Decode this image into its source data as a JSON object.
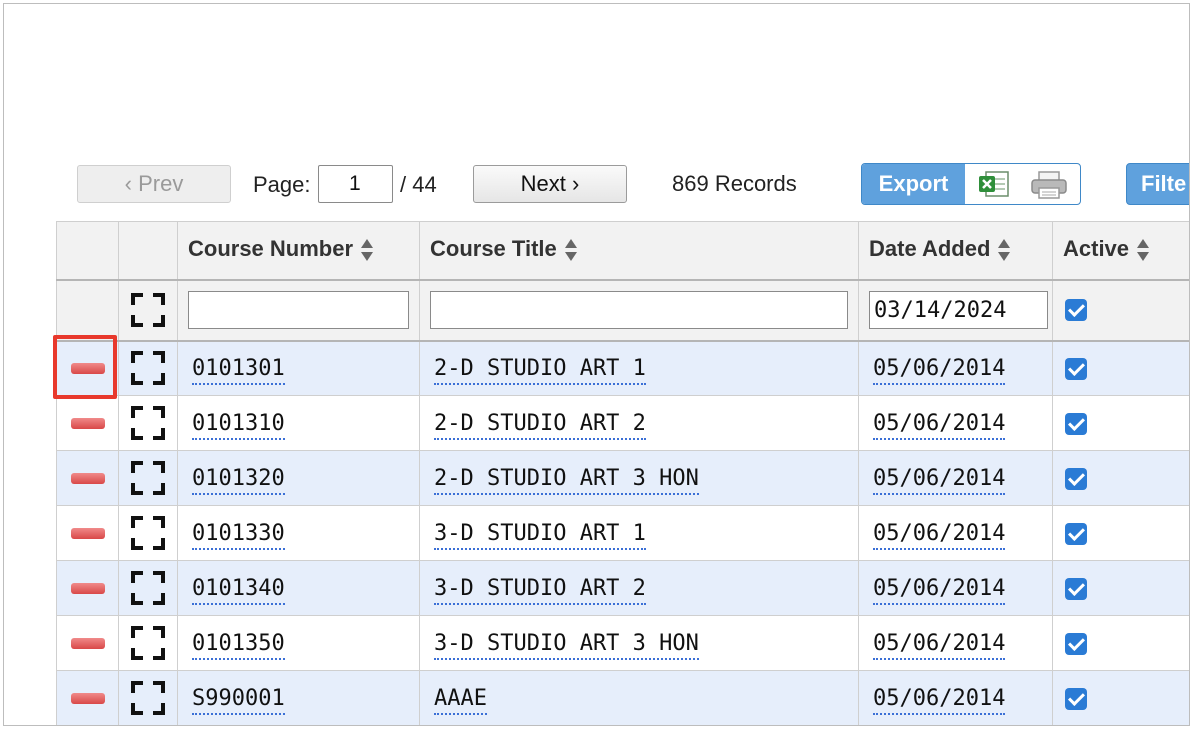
{
  "pager": {
    "prev_label": "‹ Prev",
    "page_label": "Page:",
    "page_value": "1",
    "page_total": "/ 44",
    "next_label": "Next ›",
    "records": "869 Records",
    "export_label": "Export",
    "filter_label": "Filte"
  },
  "table": {
    "columns": [
      "Course Number",
      "Course Title",
      "Date Added",
      "Active"
    ],
    "filter": {
      "course_number": "",
      "course_title": "",
      "date_added": "03/14/2024",
      "active": true
    },
    "rows": [
      {
        "course_number": "0101301",
        "course_title": "2-D STUDIO ART 1",
        "date_added": "05/06/2014",
        "active": true
      },
      {
        "course_number": "0101310",
        "course_title": "2-D STUDIO ART 2",
        "date_added": "05/06/2014",
        "active": true
      },
      {
        "course_number": "0101320",
        "course_title": "2-D STUDIO ART 3 HON",
        "date_added": "05/06/2014",
        "active": true
      },
      {
        "course_number": "0101330",
        "course_title": "3-D STUDIO ART 1",
        "date_added": "05/06/2014",
        "active": true
      },
      {
        "course_number": "0101340",
        "course_title": "3-D STUDIO ART 2",
        "date_added": "05/06/2014",
        "active": true
      },
      {
        "course_number": "0101350",
        "course_title": "3-D STUDIO ART 3 HON",
        "date_added": "05/06/2014",
        "active": true
      },
      {
        "course_number": "S990001",
        "course_title": "AAAE",
        "date_added": "05/06/2014",
        "active": true
      }
    ]
  },
  "colors": {
    "accent_blue": "#5fa1dd",
    "row_alt": "#e6eefb",
    "delete_red": "#d94848",
    "highlight_red": "#e8382c",
    "checkbox_blue": "#2a7bd5"
  },
  "icons": [
    "delete-row-icon",
    "expand-icon",
    "sort-icon",
    "excel-export-icon",
    "print-icon",
    "checkbox-checked-icon"
  ]
}
